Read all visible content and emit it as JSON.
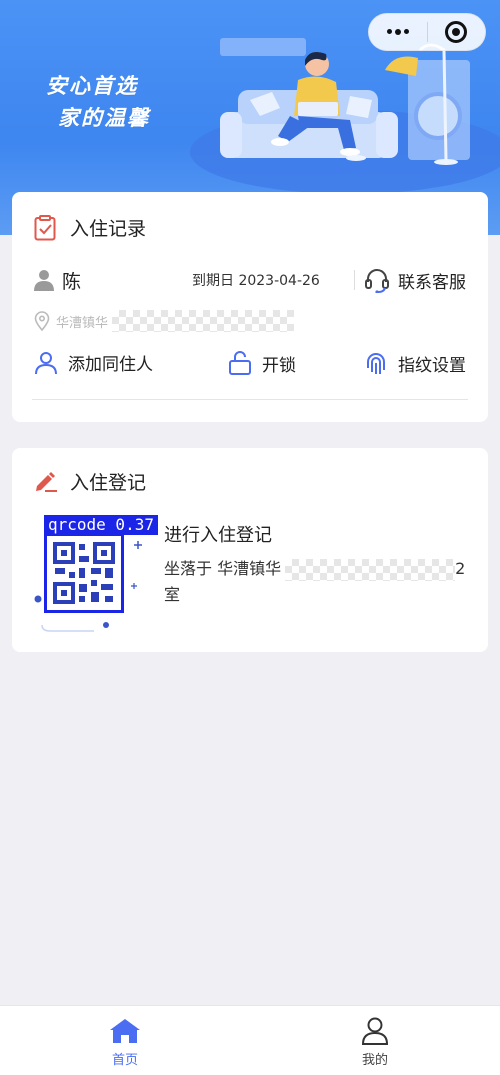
{
  "banner": {
    "slogan_line1": "安心首选",
    "slogan_line2": "家的温馨"
  },
  "capsule": {
    "more_icon": "more-dots-icon",
    "close_icon": "target-circle-icon"
  },
  "checkin_card": {
    "title": "入住记录",
    "tenant_name": "陈",
    "expire_text": "到期日 2023-04-26",
    "support_label": "联系客服",
    "address_prefix": "华漕镇华",
    "actions": [
      {
        "label": "添加同住人",
        "icon": "person-add-icon"
      },
      {
        "label": "开锁",
        "icon": "unlock-icon"
      },
      {
        "label": "指纹设置",
        "icon": "fingerprint-icon"
      }
    ]
  },
  "register_card": {
    "title": "入住登记",
    "detection_label": "qrcode 0.37",
    "action_title": "进行入住登记",
    "address_prefix": "坐落于 华漕镇华",
    "address_suffix": "2",
    "address_line2": "室"
  },
  "tabbar": {
    "items": [
      {
        "label": "首页",
        "active": true
      },
      {
        "label": "我的",
        "active": false
      }
    ]
  },
  "colors": {
    "banner_blue": "#4b93f5",
    "accent_blue": "#4a6df2",
    "detect_blue": "#1a25e8",
    "title_red": "#e0574c"
  }
}
